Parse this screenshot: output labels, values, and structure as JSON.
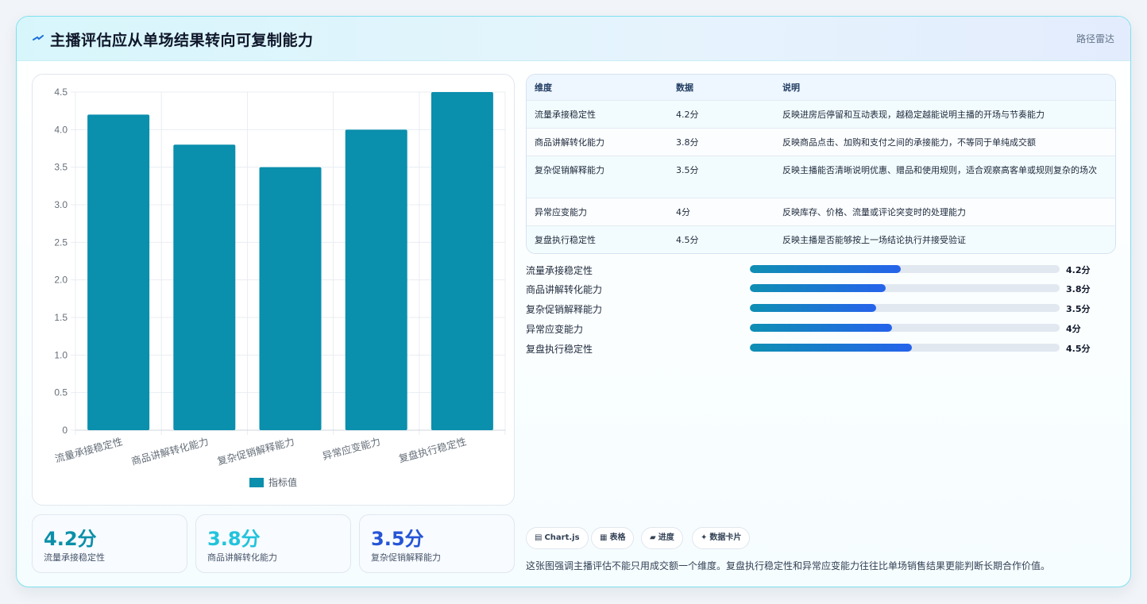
{
  "header": {
    "title": "主播评估应从单场结果转向可复制能力",
    "tag": "路径雷达",
    "icon": "spark-icon"
  },
  "colors": {
    "bar": "#0a8fad",
    "accent_teal": "#0e8fb3",
    "accent_blue": "#2563eb",
    "stat_colors": [
      "#0a8fa8",
      "#22c3dc",
      "#2554d6"
    ]
  },
  "chart_data": {
    "type": "bar",
    "categories": [
      "流量承接稳定性",
      "商品讲解转化能力",
      "复杂促销解释能力",
      "异常应变能力",
      "复盘执行稳定性"
    ],
    "series": [
      {
        "name": "指标值",
        "values": [
          4.2,
          3.8,
          3.5,
          4.0,
          4.5
        ]
      }
    ],
    "yticks": [
      "0",
      "0.5",
      "1.0",
      "1.5",
      "2.0",
      "2.5",
      "3.0",
      "3.5",
      "4.0",
      "4.5"
    ],
    "ylim": [
      0,
      4.5
    ],
    "grid": true,
    "legend": "bottom"
  },
  "stats": [
    {
      "value": "4.2分",
      "label": "流量承接稳定性"
    },
    {
      "value": "3.8分",
      "label": "商品讲解转化能力"
    },
    {
      "value": "3.5分",
      "label": "复杂促销解释能力"
    }
  ],
  "table": {
    "headers": [
      "维度",
      "数据",
      "说明"
    ],
    "rows": [
      {
        "dim": "流量承接稳定性",
        "val": "4.2分",
        "desc": "反映进房后停留和互动表现，越稳定越能说明主播的开场与节奏能力"
      },
      {
        "dim": "商品讲解转化能力",
        "val": "3.8分",
        "desc": "反映商品点击、加购和支付之间的承接能力，不等同于单纯成交额"
      },
      {
        "dim": "复杂促销解释能力",
        "val": "3.5分",
        "desc": "反映主播能否清晰说明优惠、赠品和使用规则，适合观察高客单或规则复杂的场次"
      },
      {
        "dim": "异常应变能力",
        "val": "4分",
        "desc": "反映库存、价格、流量或评论突变时的处理能力"
      },
      {
        "dim": "复盘执行稳定性",
        "val": "4.5分",
        "desc": "反映主播是否能够按上一场结论执行并接受验证"
      }
    ]
  },
  "progress": [
    {
      "label": "流量承接稳定性",
      "value": "4.2分",
      "fraction": 0.4867
    },
    {
      "label": "商品讲解转化能力",
      "value": "3.8分",
      "fraction": 0.4385
    },
    {
      "label": "复杂促销解释能力",
      "value": "3.5分",
      "fraction": 0.4077
    },
    {
      "label": "异常应变能力",
      "value": "4分",
      "fraction": 0.459
    },
    {
      "label": "复盘执行稳定性",
      "value": "4.5分",
      "fraction": 0.5231
    }
  ],
  "chips": [
    {
      "icon": "▤",
      "label": "Chart.js"
    },
    {
      "icon": "▦",
      "label": "表格"
    },
    {
      "icon": "▰",
      "label": "进度"
    },
    {
      "icon": "✦",
      "label": "数据卡片"
    }
  ],
  "footnote": "这张图强调主播评估不能只用成交额一个维度。复盘执行稳定性和异常应变能力往往比单场销售结果更能判断长期合作价值。"
}
